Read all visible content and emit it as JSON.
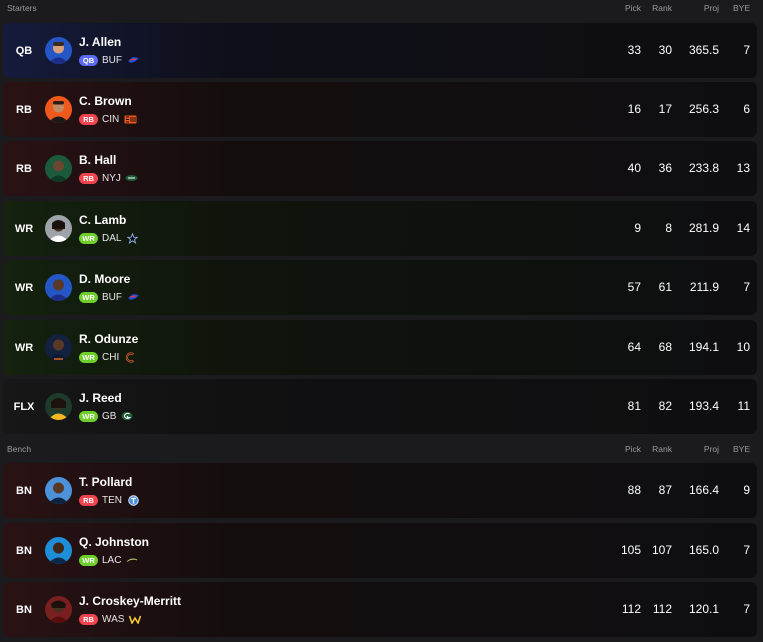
{
  "colors": {
    "qb": "#5b6cf2",
    "rb": "#f0454f",
    "wr": "#6fcf2a",
    "qb_tint": "#151b3c",
    "rb_tint": "#2a1214",
    "wr_tint": "#14220e",
    "flx_tint": "#171717",
    "bn_tint": "#2a1214"
  },
  "starters": {
    "title": "Starters",
    "columns": {
      "pick": "Pick",
      "rank": "Rank",
      "proj": "Proj",
      "bye": "BYE"
    },
    "rows": [
      {
        "slot": "QB",
        "name": "J. Allen",
        "pos": "QB",
        "team": "BUF",
        "team_icon": "bills-logo",
        "pick": "33",
        "rank": "30",
        "proj": "365.5",
        "bye": "7"
      },
      {
        "slot": "RB",
        "name": "C. Brown",
        "pos": "RB",
        "team": "CIN",
        "team_icon": "bengals-logo",
        "pick": "16",
        "rank": "17",
        "proj": "256.3",
        "bye": "6"
      },
      {
        "slot": "RB",
        "name": "B. Hall",
        "pos": "RB",
        "team": "NYJ",
        "team_icon": "jets-logo",
        "pick": "40",
        "rank": "36",
        "proj": "233.8",
        "bye": "13"
      },
      {
        "slot": "WR",
        "name": "C. Lamb",
        "pos": "WR",
        "team": "DAL",
        "team_icon": "cowboys-star",
        "pick": "9",
        "rank": "8",
        "proj": "281.9",
        "bye": "14"
      },
      {
        "slot": "WR",
        "name": "D. Moore",
        "pos": "WR",
        "team": "BUF",
        "team_icon": "bills-logo",
        "pick": "57",
        "rank": "61",
        "proj": "211.9",
        "bye": "7"
      },
      {
        "slot": "WR",
        "name": "R. Odunze",
        "pos": "WR",
        "team": "CHI",
        "team_icon": "bears-logo",
        "pick": "64",
        "rank": "68",
        "proj": "194.1",
        "bye": "10"
      },
      {
        "slot": "FLX",
        "name": "J. Reed",
        "pos": "WR",
        "team": "GB",
        "team_icon": "packers-logo",
        "pick": "81",
        "rank": "82",
        "proj": "193.4",
        "bye": "11"
      }
    ]
  },
  "bench": {
    "title": "Bench",
    "columns": {
      "pick": "Pick",
      "rank": "Rank",
      "proj": "Proj",
      "bye": "BYE"
    },
    "rows": [
      {
        "slot": "BN",
        "name": "T. Pollard",
        "pos": "RB",
        "team": "TEN",
        "team_icon": "titans-logo",
        "pick": "88",
        "rank": "87",
        "proj": "166.4",
        "bye": "9"
      },
      {
        "slot": "BN",
        "name": "Q. Johnston",
        "pos": "WR",
        "team": "LAC",
        "team_icon": "chargers-logo",
        "pick": "105",
        "rank": "107",
        "proj": "165.0",
        "bye": "7"
      },
      {
        "slot": "BN",
        "name": "J. Croskey-Merritt",
        "pos": "RB",
        "team": "WAS",
        "team_icon": "commanders-logo",
        "pick": "112",
        "rank": "112",
        "proj": "120.1",
        "bye": "7"
      }
    ]
  }
}
